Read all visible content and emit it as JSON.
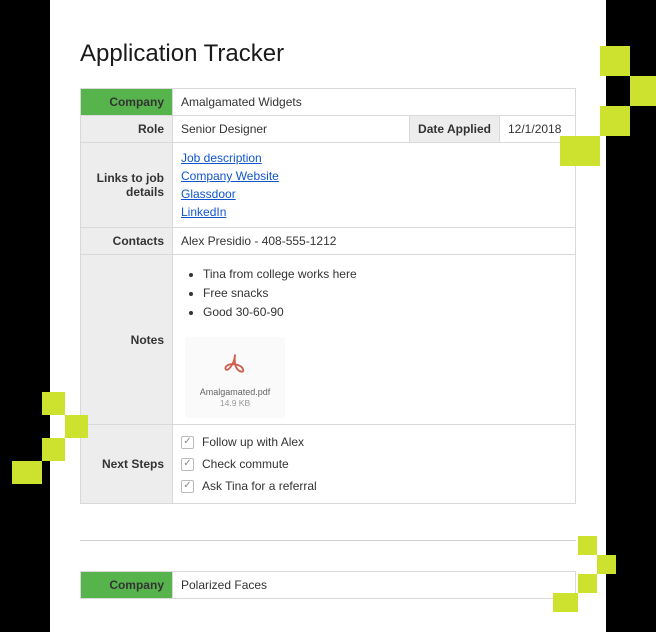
{
  "title": "Application Tracker",
  "labels": {
    "company": "Company",
    "role": "Role",
    "date_applied": "Date Applied",
    "links": "Links to job details",
    "contacts": "Contacts",
    "notes": "Notes",
    "next_steps": "Next Steps"
  },
  "applications": [
    {
      "company": "Amalgamated Widgets",
      "role": "Senior Designer",
      "date_applied": "12/1/2018",
      "links": [
        "Job description",
        "Company Website",
        "Glassdoor",
        "LinkedIn"
      ],
      "contacts": "Alex Presidio - 408-555-1212",
      "notes": [
        "Tina from college works here",
        "Free snacks",
        "Good 30-60-90"
      ],
      "attachment": {
        "name": "Amalgamated.pdf",
        "size": "14.9 KB"
      },
      "next_steps": [
        {
          "text": "Follow up with Alex",
          "checked": true
        },
        {
          "text": "Check commute",
          "checked": true
        },
        {
          "text": "Ask Tina for a referral",
          "checked": true
        }
      ]
    },
    {
      "company": "Polarized Faces"
    }
  ]
}
